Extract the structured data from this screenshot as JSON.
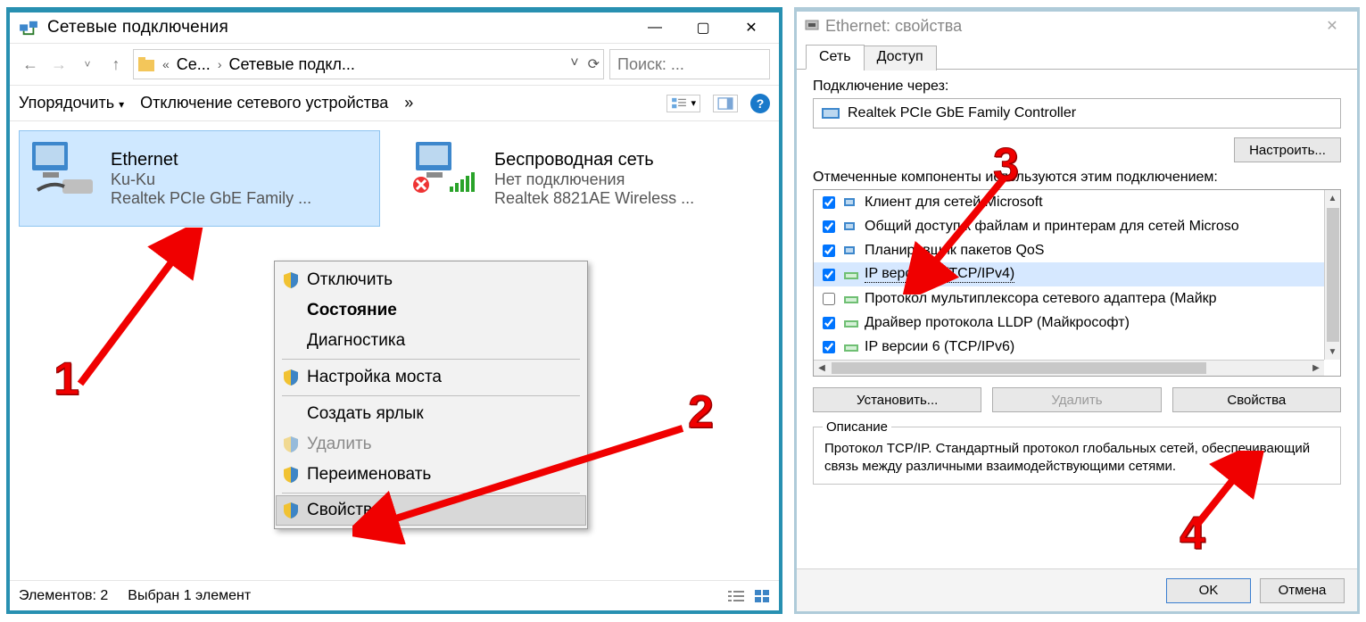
{
  "netwin": {
    "title": "Сетевые подключения",
    "nav": {
      "crumb_short": "Се...",
      "crumb_full": "Сетевые подкл...",
      "search_placeholder": "Поиск: ..."
    },
    "toolbar": {
      "organize": "Упорядочить",
      "disable": "Отключение сетевого устройства",
      "more": "»"
    },
    "adapters": {
      "ethernet": {
        "name": "Ethernet",
        "status": "Ku-Ku",
        "device": "Realtek PCIe GbE Family ..."
      },
      "wifi": {
        "name": "Беспроводная сеть",
        "status": "Нет подключения",
        "device": "Realtek 8821AE Wireless ..."
      }
    },
    "context_menu": {
      "disable": "Отключить",
      "status": "Состояние",
      "diagnose": "Диагностика",
      "bridge": "Настройка моста",
      "shortcut": "Создать ярлык",
      "delete": "Удалить",
      "rename": "Переименовать",
      "properties": "Свойства"
    },
    "status": {
      "elements": "Элементов: 2",
      "selected": "Выбран 1 элемент"
    }
  },
  "propwin": {
    "title": "Ethernet: свойства",
    "tabs": {
      "net": "Сеть",
      "access": "Доступ"
    },
    "connect_via_label": "Подключение через:",
    "connect_via_value": "Realtek PCIe GbE Family Controller",
    "configure_btn": "Настроить...",
    "components_label": "Отмеченные компоненты используются этим подключением:",
    "components": [
      {
        "checked": true,
        "label": "Клиент для сетей Microsoft"
      },
      {
        "checked": true,
        "label": "Общий доступ к файлам и принтерам для сетей Microso"
      },
      {
        "checked": true,
        "label": "Планировщик пакетов QoS"
      },
      {
        "checked": true,
        "label": "IP версии 4 (TCP/IPv4)",
        "selected": true
      },
      {
        "checked": false,
        "label": "Протокол мультиплексора сетевого адаптера (Майкр"
      },
      {
        "checked": true,
        "label": "Драйвер протокола LLDP (Майкрософт)"
      },
      {
        "checked": true,
        "label": "IP версии 6 (TCP/IPv6)"
      }
    ],
    "install_btn": "Установить...",
    "uninstall_btn": "Удалить",
    "properties_btn": "Свойства",
    "description_legend": "Описание",
    "description_text": "Протокол TCP/IP. Стандартный протокол глобальных сетей, обеспечивающий связь между различными взаимодействующими сетями.",
    "ok_btn": "OK",
    "cancel_btn": "Отмена"
  },
  "steps": {
    "s1": "1",
    "s2": "2",
    "s3": "3",
    "s4": "4"
  }
}
